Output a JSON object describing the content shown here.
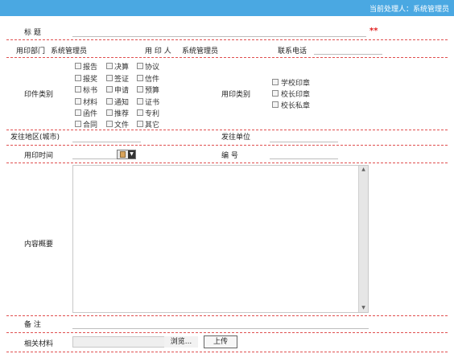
{
  "header": {
    "current_handler": "当前处理人：系统管理员"
  },
  "form": {
    "title_label": "标    题",
    "required_mark": "**",
    "dept_label": "用印部门",
    "dept_value": "系统管理员",
    "user_label": "用 印 人",
    "user_value": "系统管理员",
    "phone_label": "联系电话",
    "doc_type_label": "印件类别",
    "doc_types": [
      "报告",
      "决算",
      "协议",
      "报奖",
      "签证",
      "信件",
      "标书",
      "申请",
      "预算",
      "材料",
      "通知",
      "证书",
      "函件",
      "推荐",
      "专利",
      "合同",
      "文件",
      "其它"
    ],
    "seal_type_label": "用印类别",
    "seal_types": [
      "学校印章",
      "校长印章",
      "校长私章"
    ],
    "send_region_label": "发往地区(城市)",
    "send_unit_label": "发往单位",
    "use_time_label": "用印时间",
    "number_label": "编      号",
    "content_label": "内容概要",
    "remark_label": "备    注",
    "attachment_label": "相关材料",
    "browse_label": "浏览...",
    "upload_label": "上传"
  }
}
